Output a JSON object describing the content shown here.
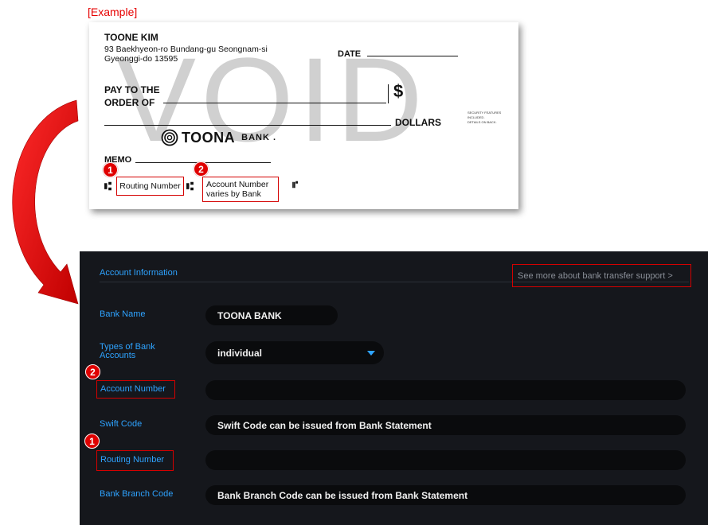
{
  "example_label": "[Example]",
  "check": {
    "watermark": "VOID",
    "owner_name": "TOONE KIM",
    "owner_address_1": "93 Baekhyeon-ro Bundang-gu Seongnam-si",
    "owner_address_2": "Gyeonggi-do 13595",
    "date_label": "DATE",
    "pay_to_1": "PAY TO THE",
    "pay_to_2": "ORDER OF",
    "dollar_sign": "$",
    "dollars_label": "DOLLARS",
    "security_note_1": "SECURITY FEATURES",
    "security_note_2": "INCLUDED.",
    "security_note_3": "DETAILS ON BACK.",
    "bank_logo_name": "TOONA",
    "bank_logo_suffix": "BANK .",
    "memo_label": "MEMO",
    "routing_label": "Routing Number",
    "account_label_1": "Account Number",
    "account_label_2": "varies by Bank",
    "micr_1": "⑆",
    "micr_2": "⑆",
    "micr_3": "⑈"
  },
  "badges": {
    "one": "1",
    "two": "2"
  },
  "panel": {
    "section_title": "Account Information",
    "more_link": "See more about bank transfer support >",
    "labels": {
      "bank_name": "Bank Name",
      "types_of_accounts": "Types of Bank Accounts",
      "account_number": "Account Number",
      "swift_code": "Swift Code",
      "routing_number": "Routing Number",
      "bank_branch_code": "Bank Branch Code"
    },
    "values": {
      "bank_name": "TOONA BANK",
      "types_of_accounts": "individual",
      "account_number": "",
      "swift_code": "Swift Code can be issued from Bank Statement",
      "routing_number": "",
      "bank_branch_code": "Bank Branch Code can be issued from Bank Statement"
    }
  },
  "colors": {
    "accent_blue": "#2ea3ff",
    "highlight_red": "#d40000",
    "panel_bg": "#15171c",
    "field_bg": "#0a0b0d"
  }
}
